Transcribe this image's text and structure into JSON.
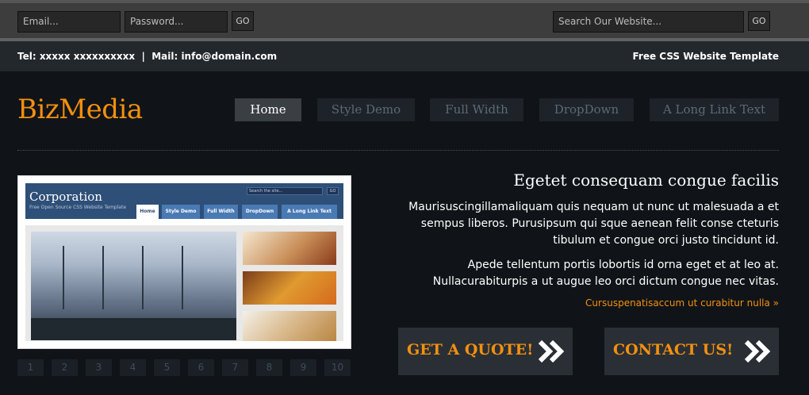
{
  "login": {
    "email_placeholder": "Email...",
    "password_placeholder": "Password...",
    "go_label": "GO"
  },
  "search": {
    "placeholder": "Search Our Website...",
    "go_label": "GO"
  },
  "infobar": {
    "contact": "Tel: xxxxx xxxxxxxxxx  |  Mail: info@domain.com",
    "tagline": "Free CSS Website Template"
  },
  "header": {
    "logo": "BizMedia"
  },
  "nav": {
    "items": [
      "Home",
      "Style Demo",
      "Full Width",
      "DropDown",
      "A Long Link Text"
    ],
    "active": "Home"
  },
  "slider": {
    "screenshot": {
      "title": "Corporation",
      "subtitle": "Free Open Source CSS Website Template",
      "search_placeholder": "Search the site...",
      "go_label": "GO",
      "tabs": [
        "Home",
        "Style Demo",
        "Full Width",
        "DropDown",
        "A Long Link Text"
      ]
    },
    "pages": [
      "1",
      "2",
      "3",
      "4",
      "5",
      "6",
      "7",
      "8",
      "9",
      "10"
    ]
  },
  "intro": {
    "headline": "Egetet consequam congue facilis",
    "paragraph1": "Maurisuscingillamaliquam quis nequam ut nunc ut malesuada a et sempus liberos. Purusipsum qui sque aenean felit conse cteturis tibulum et congue orci justo tincidunt id.",
    "paragraph2": "Apede tellentum portis lobortis id orna eget et at leo at. Nullacurabiturpis a ut augue leo orci dictum congue nec vitas.",
    "read_more": "Cursuspenatisaccum ut curabitur nulla »"
  },
  "cta": {
    "quote_label": "GET A QUOTE!",
    "contact_label": "CONTACT US!"
  },
  "colors": {
    "accent": "#f39010",
    "background": "#101418"
  }
}
